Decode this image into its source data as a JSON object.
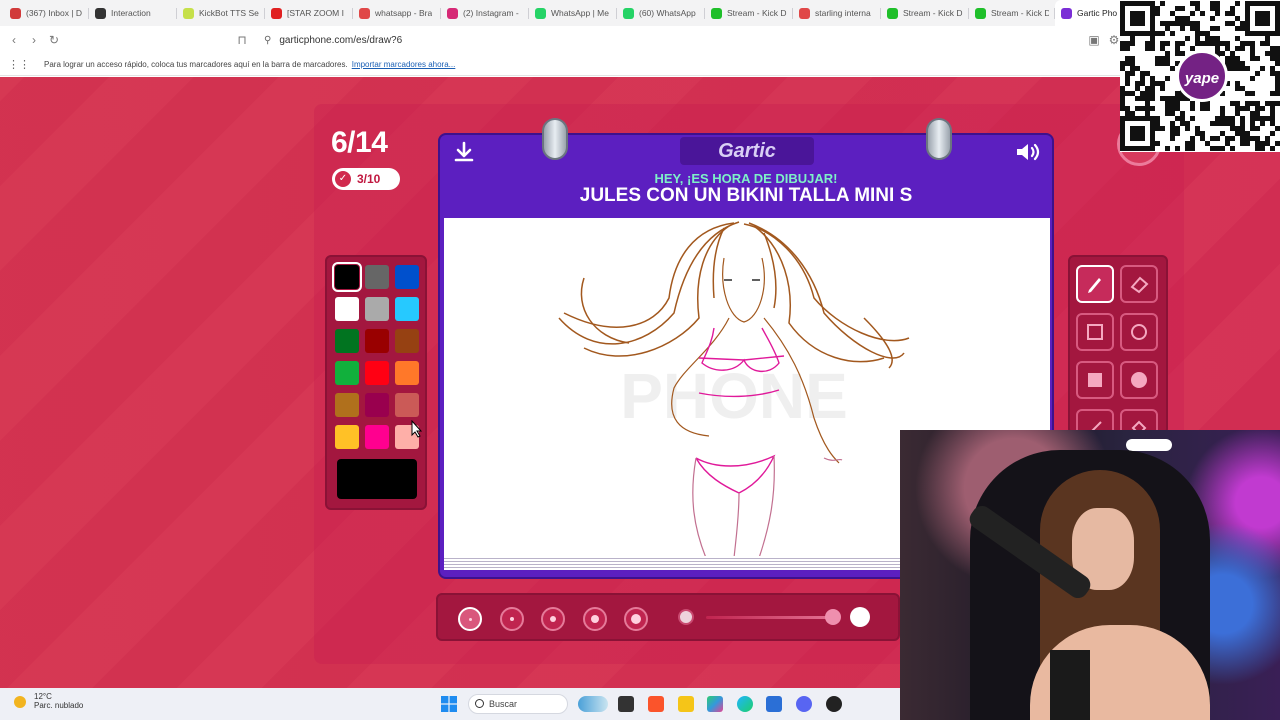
{
  "browser": {
    "tabs": [
      {
        "label": "(367) Inbox | D",
        "color": "#d13a3a"
      },
      {
        "label": "Interaction",
        "color": "#333333"
      },
      {
        "label": "KickBot TTS Se",
        "color": "#c6e04a"
      },
      {
        "label": "[STAR ZOOM I",
        "color": "#e02020"
      },
      {
        "label": "whatsapp - Bra",
        "color": "#e04848"
      },
      {
        "label": "(2) Instagram -",
        "color": "#d62976"
      },
      {
        "label": "WhatsApp | Me",
        "color": "#25d366"
      },
      {
        "label": "(60) WhatsApp",
        "color": "#25d366"
      },
      {
        "label": "Stream - Kick D",
        "color": "#1fbf2a"
      },
      {
        "label": "starling interna",
        "color": "#e04848"
      },
      {
        "label": "Stream - Kick D",
        "color": "#1fbf2a"
      },
      {
        "label": "Stream - Kick D",
        "color": "#1fbf2a"
      },
      {
        "label": "Gartic Pho",
        "color": "#7b2ed6",
        "active": true
      }
    ],
    "url": "garticphone.com/es/draw?6",
    "bookmarks_text": "Para lograr un acceso rápido, coloca tus marcadores aquí en la barra de marcadores.",
    "bookmarks_link": "Importar marcadores ahora..."
  },
  "game": {
    "round": "6/14",
    "done_count": "3/10",
    "logo": "Gartic",
    "hint": "HEY, ¡ES HORA DE DIBUJAR!",
    "prompt": "JULES CON UN BIKINI TALLA MINI S",
    "palette": [
      "#000000",
      "#666666",
      "#0050cd",
      "#ffffff",
      "#aaaaaa",
      "#26c9ff",
      "#017420",
      "#990000",
      "#964112",
      "#11b03c",
      "#ff0013",
      "#ff7829",
      "#b0701c",
      "#99004e",
      "#cb5a57",
      "#ffc126",
      "#ff008f",
      "#feafa8"
    ],
    "current_color": "#000000",
    "tools": [
      "pencil",
      "eraser",
      "rectangle-outline",
      "circle-outline",
      "rectangle-filled",
      "circle-filled",
      "line",
      "fill"
    ],
    "brush_sizes": 5
  },
  "overlay": {
    "qr_brand": "yape"
  },
  "taskbar": {
    "temperature": "12°C",
    "weather": "Parc. nublado",
    "search_placeholder": "Buscar"
  }
}
